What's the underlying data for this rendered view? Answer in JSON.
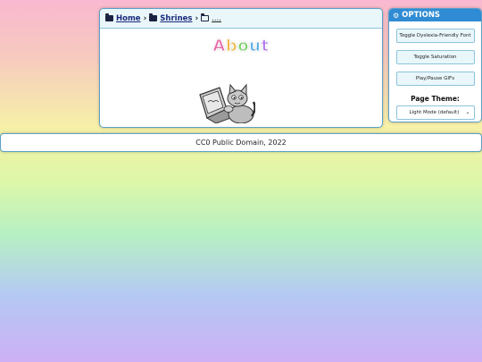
{
  "breadcrumb": {
    "home": "Home",
    "shrines": "Shrines",
    "current": "...."
  },
  "page": {
    "title_letters": [
      "A",
      "b",
      "o",
      "u",
      "t"
    ],
    "title_colors": [
      "#e86aa8",
      "#f0b84a",
      "#7ad06a",
      "#5aaee8",
      "#b07ae8"
    ]
  },
  "options": {
    "header": "OPTIONS",
    "buttons": [
      "Toggle Dyslexia-Friendly Font",
      "Toggle Saturation",
      "Play/Pause GIFs"
    ],
    "theme_label": "Page Theme:",
    "theme_selected": "Light Mode (default)"
  },
  "footer": {
    "text": "CC0 Public Domain, 2022"
  }
}
